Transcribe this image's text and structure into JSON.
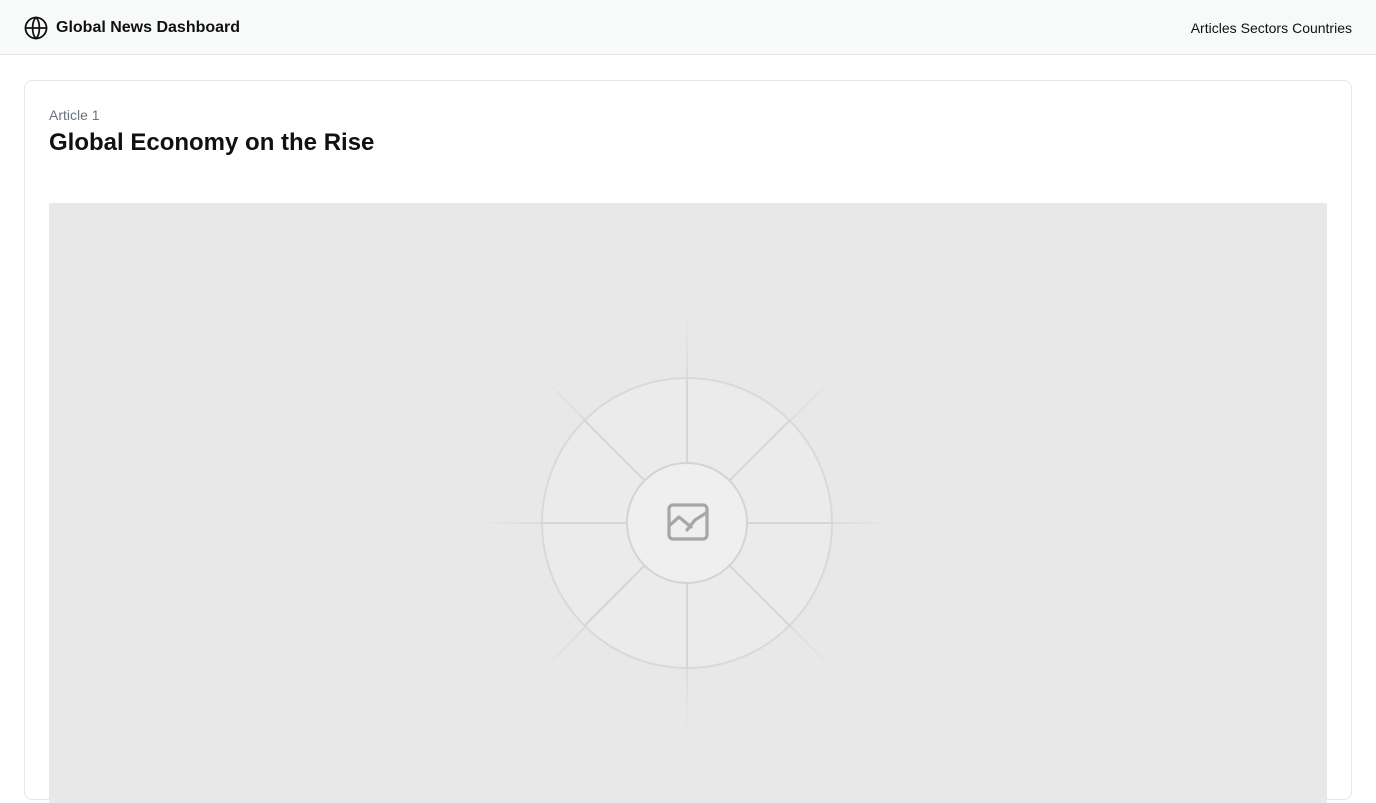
{
  "header": {
    "title": "Global News Dashboard",
    "logo_icon": "globe-icon",
    "nav": [
      "Articles",
      "Sectors",
      "Countries"
    ]
  },
  "article": {
    "label": "Article 1",
    "title": "Global Economy on the Rise",
    "image_icon": "image-placeholder-icon"
  },
  "colors": {
    "header_bg": "#f8fafa",
    "border": "#e4e7e9",
    "placeholder_bg": "#e8e8e8",
    "muted_text": "#6b7280"
  }
}
